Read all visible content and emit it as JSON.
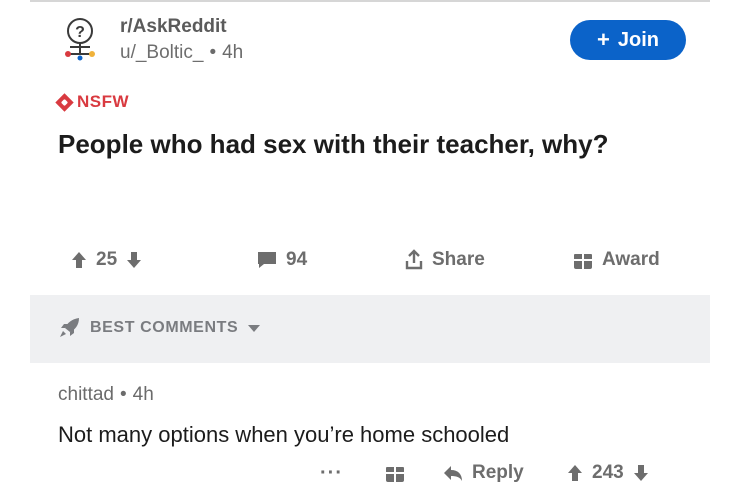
{
  "post": {
    "subreddit": "r/AskReddit",
    "author": "u/_Boltic_",
    "separator": "•",
    "age": "4h",
    "join_label": "Join",
    "join_plus": "+",
    "nsfw_label": "NSFW",
    "title": "People who had sex with their teacher, why?",
    "upvotes": "25",
    "comments": "94",
    "share_label": "Share",
    "award_label": "Award"
  },
  "sort": {
    "label": "BEST COMMENTS"
  },
  "comment": {
    "author": "chittad",
    "separator": "•",
    "age": "4h",
    "body": "Not many options when you’re home schooled",
    "more": "···",
    "reply_label": "Reply",
    "score": "243"
  },
  "colors": {
    "accent": "#0b63c9",
    "nsfw": "#d93a40",
    "muted": "#6d6d6d",
    "bar_bg": "#eff0f2"
  }
}
